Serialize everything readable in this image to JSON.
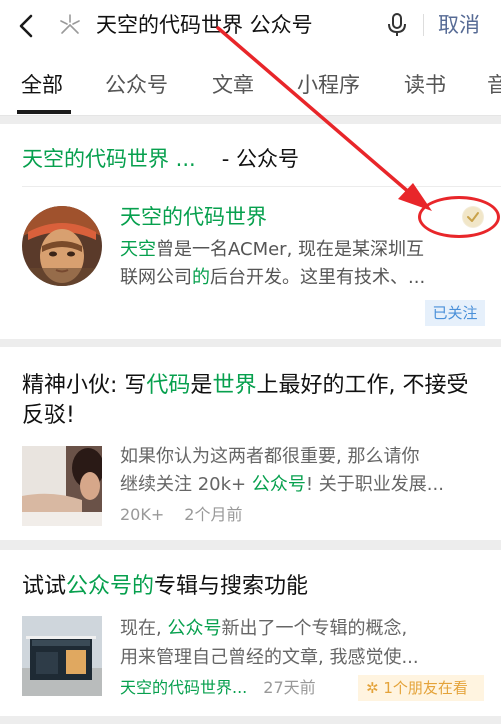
{
  "search": {
    "query": "天空的代码世界 公众号",
    "cancel_label": "取消"
  },
  "tabs": [
    {
      "label": "全部",
      "active": true
    },
    {
      "label": "公众号"
    },
    {
      "label": "文章"
    },
    {
      "label": "小程序"
    },
    {
      "label": "读书"
    },
    {
      "label": "音"
    }
  ],
  "account_card": {
    "header_highlight": "天空的代码世界 ...",
    "header_suffix": "- 公众号",
    "name": "天空的代码世界",
    "desc_line1_hl": "天空",
    "desc_line1_rest": "曾是一名ACMer, 现在是某深圳互",
    "desc_line2_a": "联网公司",
    "desc_line2_hl": "的",
    "desc_line2_b": "后台开发。这里有技术、...",
    "follow_status": "已关注"
  },
  "article1": {
    "title_a": "精神小伙: 写",
    "title_hl1": "代码",
    "title_b": "是",
    "title_hl2": "世界",
    "title_c": "上最好的工作, 不接受反驳!",
    "desc_line1": "如果你认为这两者都很重要, 那么请你",
    "desc_line2_a": "继续关注 20k+ ",
    "desc_line2_hl": "公众号",
    "desc_line2_b": "! 关于职业发展...",
    "reads": "20K+",
    "time": "2个月前"
  },
  "article2": {
    "title_a": "试试",
    "title_hl": "公众号的",
    "title_b": "专辑与搜索功能",
    "desc_line1_a": "现在, ",
    "desc_line1_hl": "公众号",
    "desc_line1_b": "新出了一个专辑的概念,",
    "desc_line2": "用来管理自己曾经的文章, 我感觉使...",
    "source": "天空的代码世界...",
    "time": "27天前",
    "friends": "1个朋友在看"
  },
  "colors": {
    "highlight": "#07a04e",
    "link": "#576b95",
    "annotation": "#e8262a"
  }
}
